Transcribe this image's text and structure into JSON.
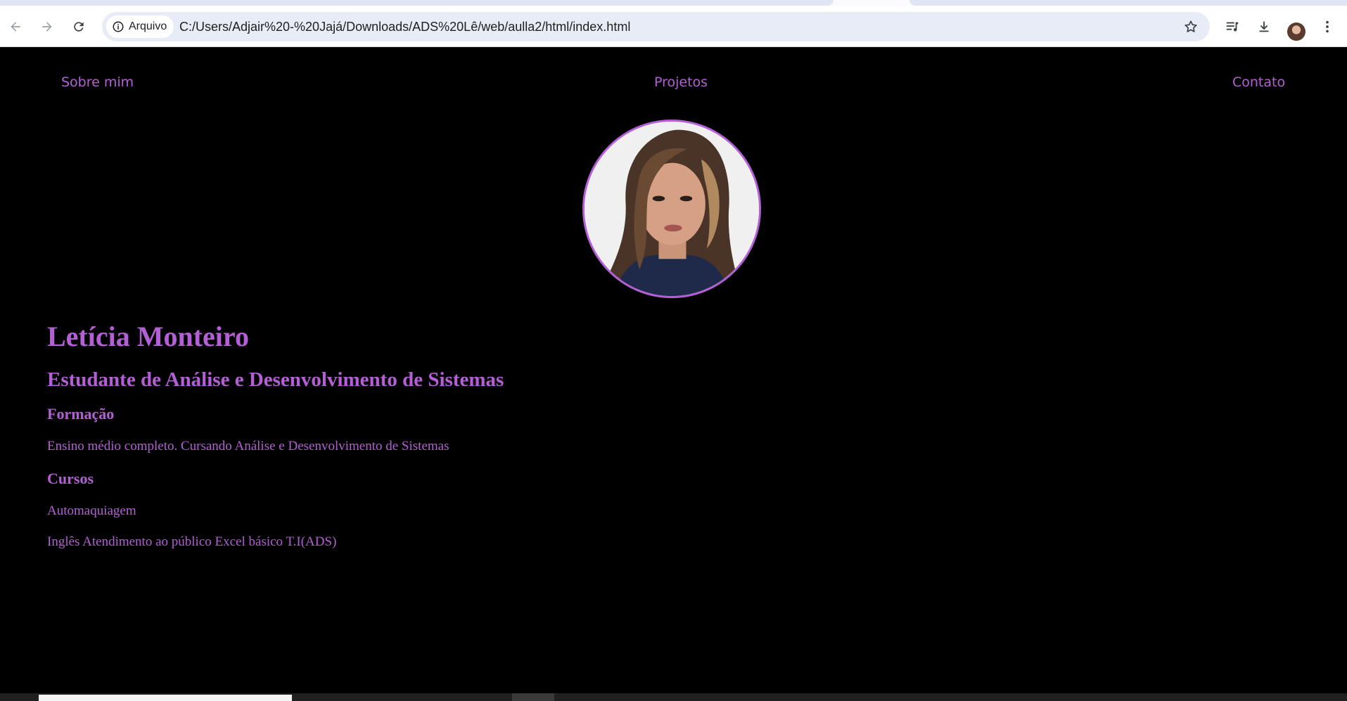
{
  "browser": {
    "site_info_label": "Arquivo",
    "url": "C:/Users/Adjair%20-%20Jajá/Downloads/ADS%20Lê/web/aulla2/html/index.html",
    "icons": {
      "back": "arrow-left-icon",
      "forward": "arrow-right-icon",
      "reload": "reload-icon",
      "info": "info-icon",
      "bookmark": "star-icon",
      "media": "media-queue-icon",
      "download": "download-icon",
      "menu": "kebab-menu-icon"
    }
  },
  "nav": {
    "about": "Sobre mim",
    "projects": "Projetos",
    "contact": "Contato"
  },
  "profile": {
    "name": "Letícia Monteiro",
    "role": "Estudante de Análise e Desenvolvimento de Sistemas"
  },
  "education": {
    "heading": "Formação",
    "text": "Ensino médio completo. Cursando Análise e Desenvolvimento de Sistemas"
  },
  "courses": {
    "heading": "Cursos",
    "line1": "Automaquiagem",
    "line2": "Inglês Atendimento ao público Excel básico T.I(ADS)"
  },
  "colors": {
    "accent": "#b45fd6",
    "background": "#000000"
  }
}
